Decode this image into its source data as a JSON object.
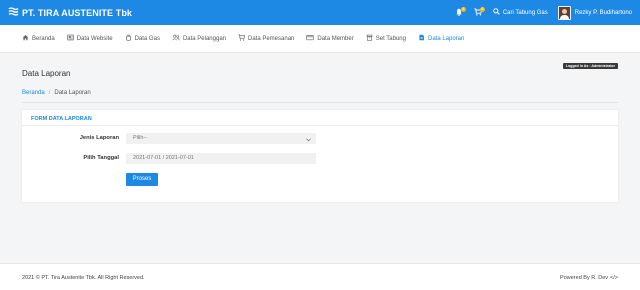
{
  "header": {
    "brand": "PT. TIRA AUSTENITE Tbk",
    "notif_count": "0",
    "cart_count": "0",
    "search_label": "Cari Tabung Gas",
    "user_name": "Rezky P. Budihartono"
  },
  "nav": {
    "items": [
      {
        "label": "Beranda",
        "icon": "home-icon"
      },
      {
        "label": "Data Website",
        "icon": "website-icon"
      },
      {
        "label": "Data Gas",
        "icon": "gas-icon"
      },
      {
        "label": "Data Pelanggan",
        "icon": "users-icon"
      },
      {
        "label": "Data Pemesanan",
        "icon": "cart-icon"
      },
      {
        "label": "Data Member",
        "icon": "card-icon"
      },
      {
        "label": "Set Tabung",
        "icon": "tank-icon"
      },
      {
        "label": "Data Laporan",
        "icon": "report-icon"
      }
    ],
    "active": "Data Laporan"
  },
  "page": {
    "title": "Data Laporan",
    "logged_badge": "Logged In As : Administrator",
    "breadcrumb": {
      "home": "Beranda",
      "separator": "/",
      "current": "Data Laporan"
    }
  },
  "form": {
    "title": "FORM DATA LAPORAN",
    "jenis_label": "Jenis Laporan",
    "jenis_value": "Pilih--",
    "tanggal_label": "Pilih Tanggal",
    "tanggal_value": "2021-07-01 / 2021-07-01",
    "submit_label": "Proses"
  },
  "footer": {
    "copyright": "2021 © PT. Tira Austenite Tbk. All Right Reserved.",
    "powered": "Powered By R. Dev",
    "code_symbol": "</>"
  },
  "colors": {
    "primary": "#1e88e5",
    "badge": "#ffb300",
    "background": "#f4f5f7"
  }
}
